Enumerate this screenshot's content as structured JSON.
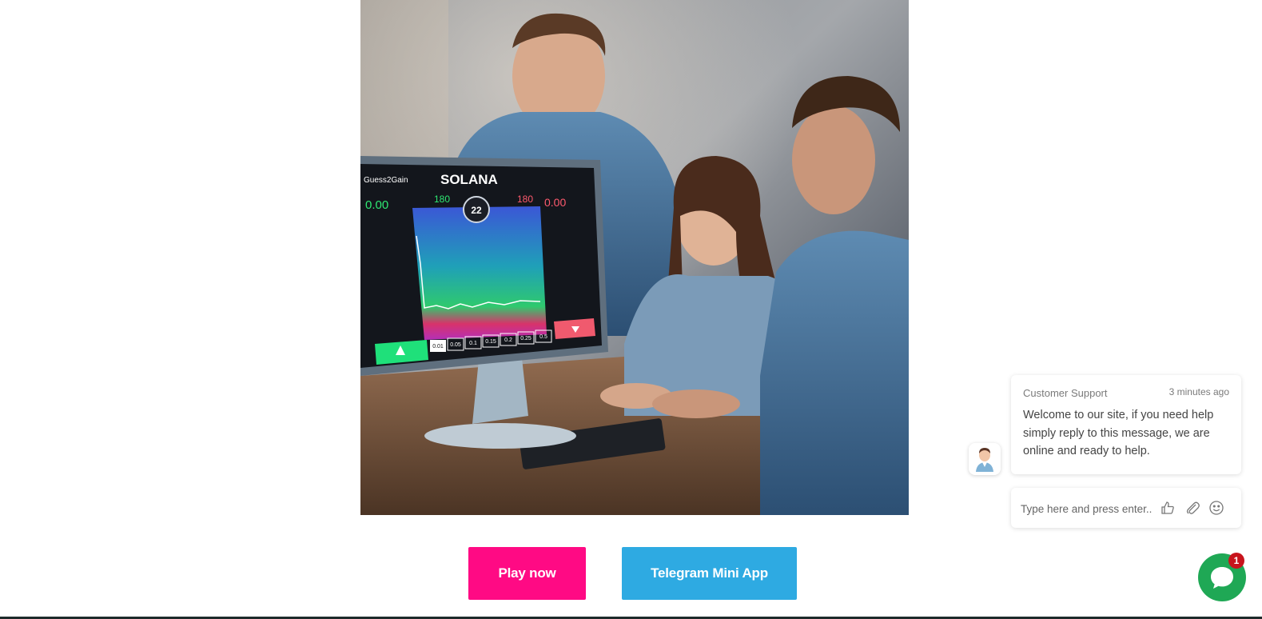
{
  "hero": {
    "image_alt": "Family playing Guess2Gain Solana game on a computer",
    "screen": {
      "brand": "Guess2Gain",
      "logo": "SOLANA",
      "timer": "22",
      "left_value": "0.00",
      "right_value": "0.00",
      "multiplier_left": "180",
      "multiplier_right": "180",
      "bets": [
        "0.01",
        "0.05",
        "0.1",
        "0.15",
        "0.2",
        "0.25",
        "0.5"
      ]
    }
  },
  "actions": {
    "play_label": "Play now",
    "telegram_label": "Telegram Mini App"
  },
  "colors": {
    "play_bg": "#ff0a84",
    "telegram_bg": "#2eaae2",
    "chat_green": "#1fa855",
    "badge_red": "#c8141c"
  },
  "chat": {
    "sender": "Customer Support",
    "time": "3 minutes ago",
    "message": "Welcome to our site, if you need help simply reply to this message, we are online and ready to help.",
    "input_placeholder": "Type here and press enter..",
    "icons": [
      "thumbs-up-icon",
      "paperclip-icon",
      "smiley-icon"
    ],
    "unread_count": "1"
  }
}
